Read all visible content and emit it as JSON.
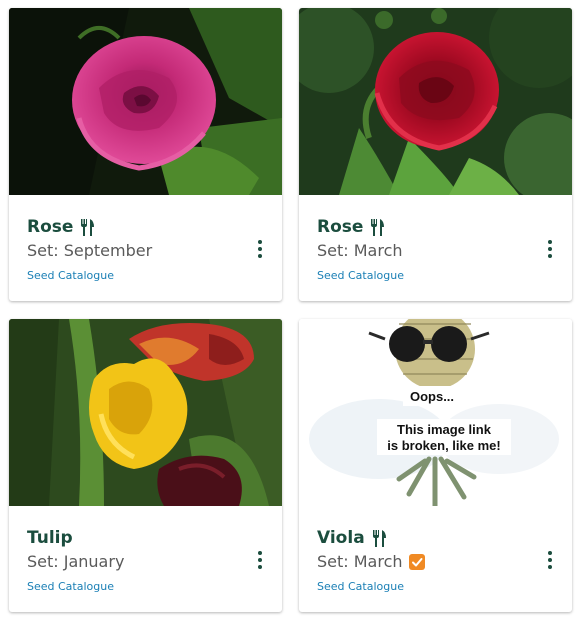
{
  "cards": [
    {
      "name": "Rose",
      "set": "Set: September",
      "catalogue": "Seed Catalogue",
      "edible": true,
      "checked": false,
      "image_subject": "pink rose"
    },
    {
      "name": "Rose",
      "set": "Set: March",
      "catalogue": "Seed Catalogue",
      "edible": true,
      "checked": false,
      "image_subject": "red rose"
    },
    {
      "name": "Tulip",
      "set": "Set: January",
      "catalogue": "Seed Catalogue",
      "edible": false,
      "checked": false,
      "image_subject": "yellow and red tulips"
    },
    {
      "name": "Viola",
      "set": "Set: March",
      "catalogue": "Seed Catalogue",
      "edible": true,
      "checked": true,
      "image_subject": "broken image placeholder with pineapple in sunglasses",
      "broken_image": {
        "line1": "Oops...",
        "line2": "This image link",
        "line3": "is broken, like me!"
      }
    }
  ],
  "colors": {
    "title": "#1b4d3e",
    "subtitle": "#5a5a5a",
    "link": "#1a7fb5",
    "checkbox": "#f08a24"
  },
  "icons": {
    "edible": "fork-knife-icon",
    "more": "more-vert-icon",
    "checked": "checkbox-checked-icon"
  }
}
